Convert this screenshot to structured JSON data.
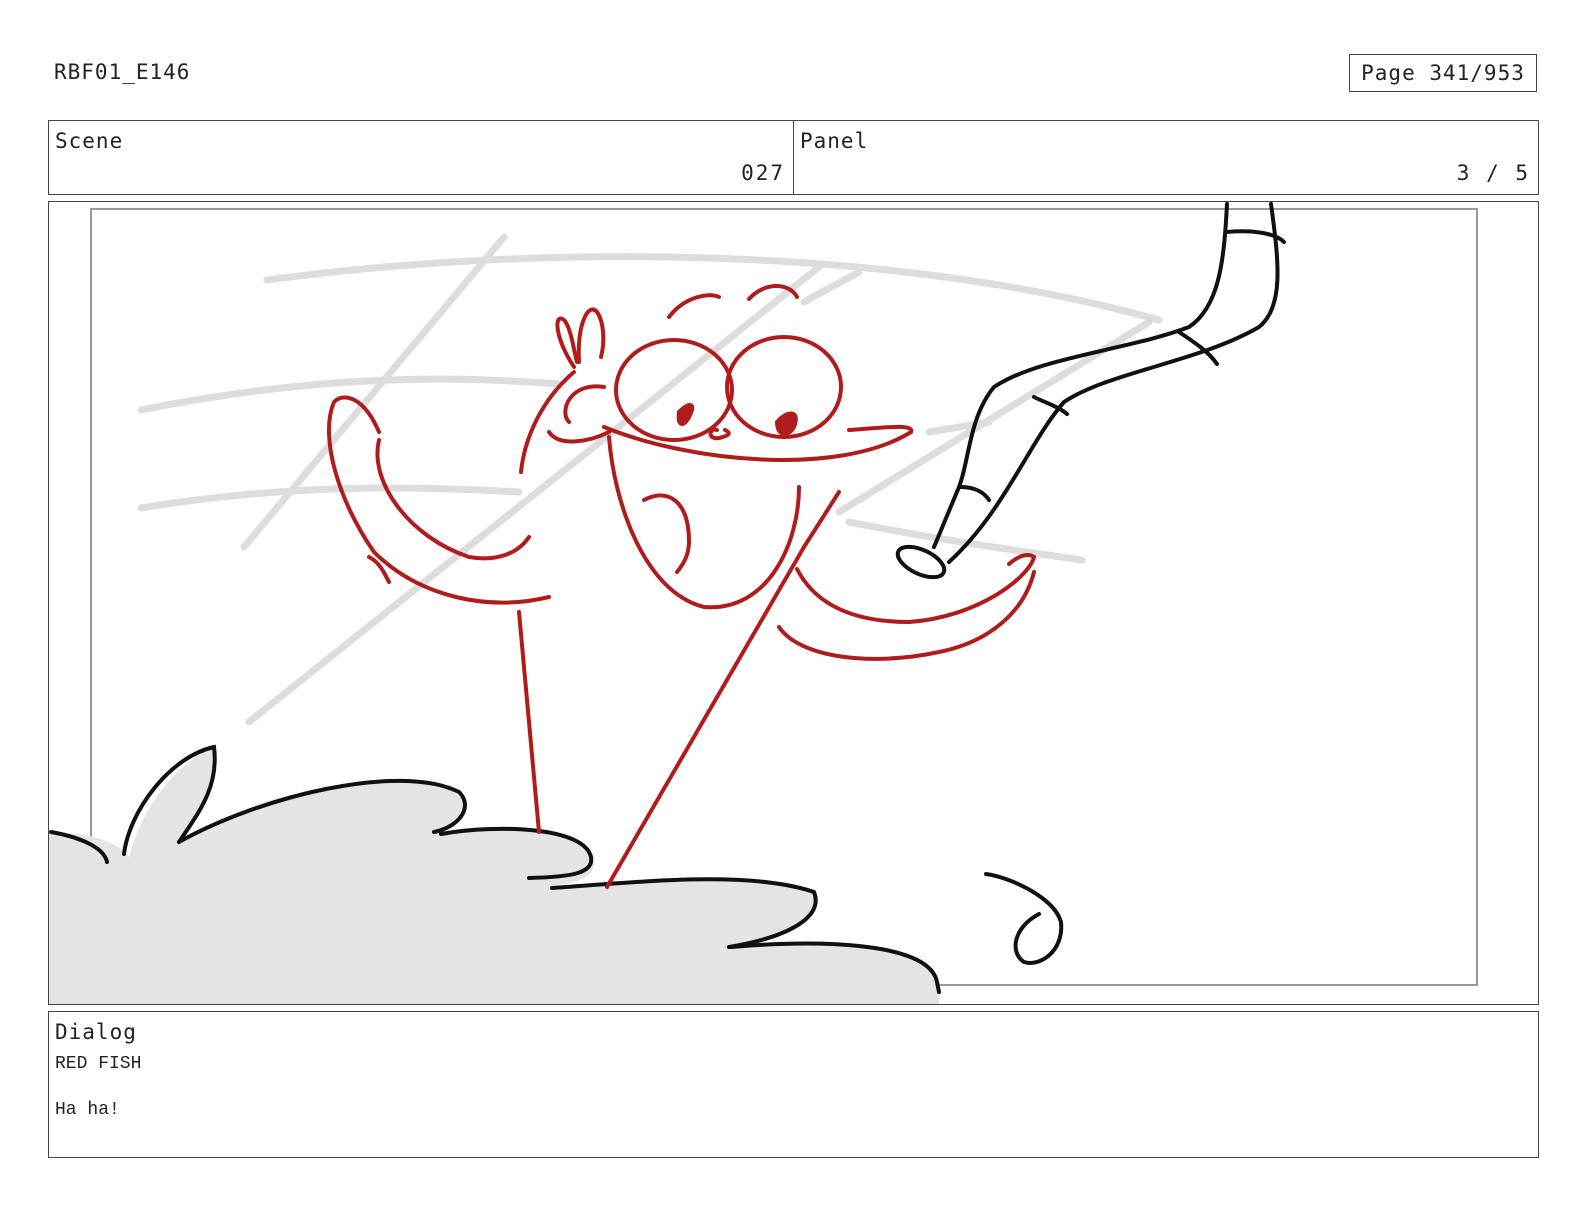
{
  "header": {
    "doc_id": "RBF01_E146",
    "page": "Page 341/953"
  },
  "scene": {
    "label": "Scene",
    "value": "027"
  },
  "panel": {
    "label": "Panel",
    "value": "3 / 5"
  },
  "dialog": {
    "label": "Dialog",
    "speaker": "RED FISH",
    "line": "Ha ha!"
  },
  "colors": {
    "character_stroke": "#b01c1c",
    "ink_stroke": "#111111",
    "rough_stroke": "#dddddd",
    "cloud_fill": "#e4e4e4",
    "frame_border": "#999999"
  },
  "illustration": {
    "subject_icon": "storyboard-sketch-icon"
  }
}
